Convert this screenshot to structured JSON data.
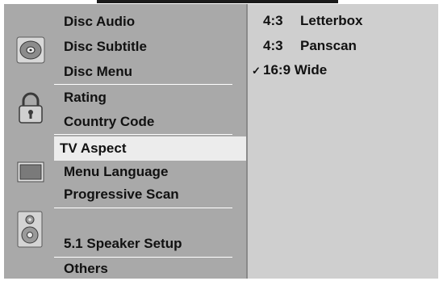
{
  "menu": {
    "items": [
      {
        "label": "Disc Audio"
      },
      {
        "label": "Disc Subtitle"
      },
      {
        "label": "Disc Menu"
      },
      {
        "label": "Rating"
      },
      {
        "label": "Country Code"
      },
      {
        "label": "TV Aspect"
      },
      {
        "label": "Menu Language"
      },
      {
        "label": "Progressive Scan"
      },
      {
        "label": "5.1 Speaker Setup"
      },
      {
        "label": "Others"
      }
    ],
    "selected_index": 5
  },
  "options": [
    {
      "ratio": "4:3",
      "name": "Letterbox",
      "checked": false
    },
    {
      "ratio": "4:3",
      "name": "Panscan",
      "checked": false
    },
    {
      "ratio": "16:9",
      "name": "Wide",
      "checked": true
    }
  ],
  "check_glyph": "✓",
  "icons": [
    "disc-icon",
    "lock-icon",
    "tv-screen-icon",
    "speaker-icon"
  ],
  "colors": {
    "panel_bg": "#a9a9a9",
    "options_bg": "#cfcfcf",
    "selected_bg": "#ececec",
    "text": "#111111"
  }
}
